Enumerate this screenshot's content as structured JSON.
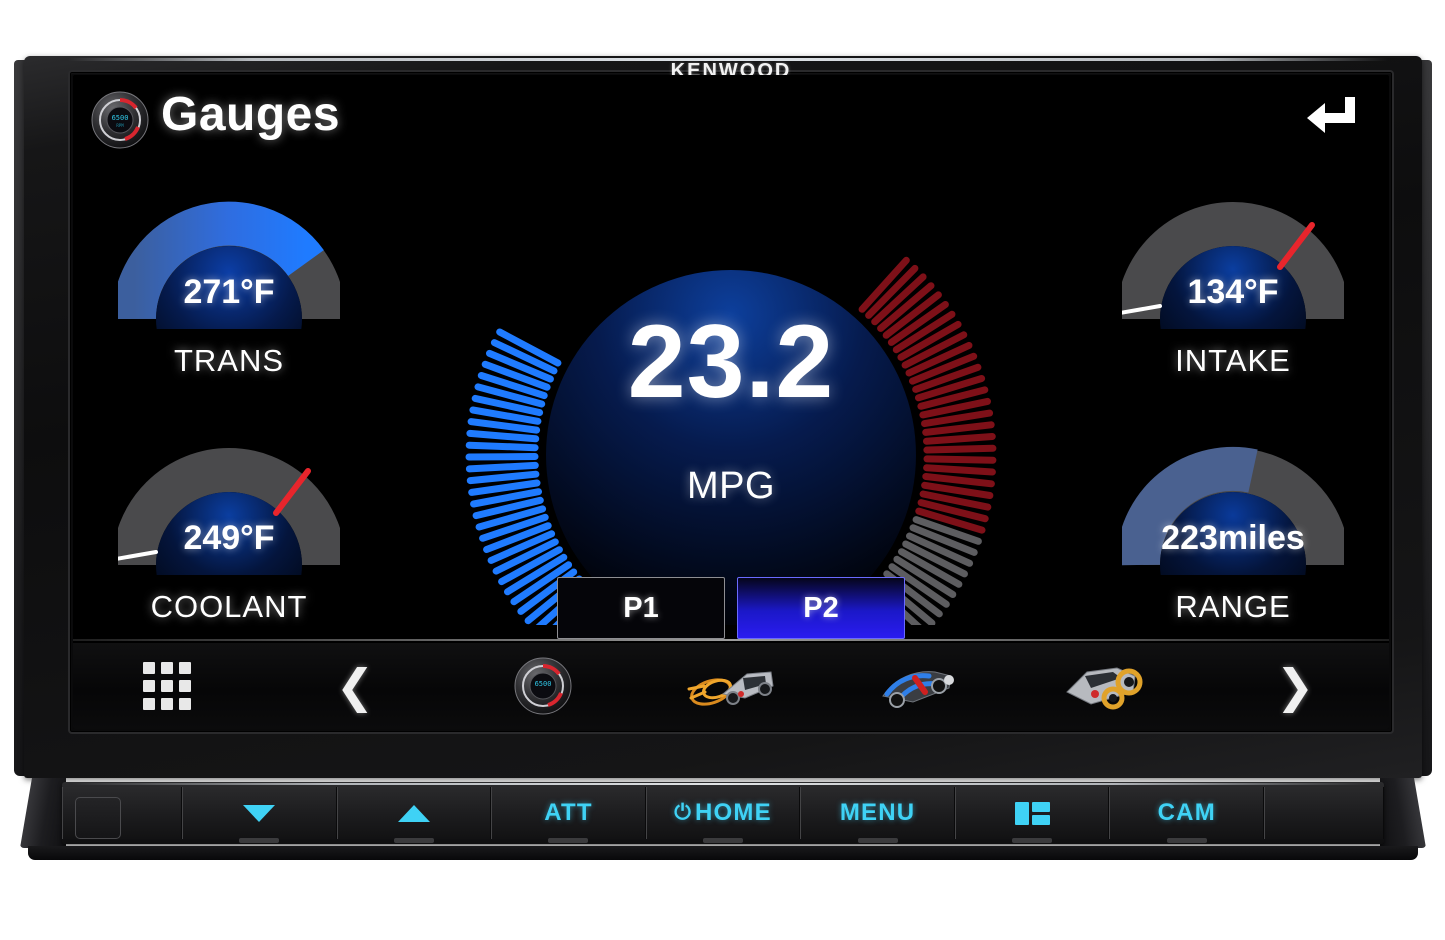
{
  "brand": "KENWOOD",
  "screen": {
    "header": {
      "title": "Gauges",
      "icon": "gauge-dial-icon",
      "back_icon": "back-arrow-icon"
    },
    "gauges": {
      "left": [
        {
          "id": "trans",
          "value": "271°F",
          "label": "TRANS",
          "style": "blue-arc",
          "fill_deg": 250,
          "needle": null
        },
        {
          "id": "coolant",
          "value": "249°F",
          "label": "COOLANT",
          "style": "grey-arc",
          "fill_deg": 0,
          "needle": "red"
        }
      ],
      "right": [
        {
          "id": "intake",
          "value": "134°F",
          "label": "INTAKE",
          "style": "grey-arc",
          "fill_deg": 0,
          "needle": "red"
        },
        {
          "id": "range",
          "value": "223miles",
          "label": "RANGE",
          "style": "dim-blue",
          "fill_deg": 195,
          "needle": null
        }
      ],
      "center": {
        "id": "mpg",
        "value": "23.2",
        "unit": "MPG",
        "tick_count": 100,
        "blue_ticks": 44,
        "grey_ticks": 30,
        "red_ticks": 26
      }
    },
    "presets": [
      {
        "label": "P1",
        "active": false
      },
      {
        "label": "P2",
        "active": true
      }
    ],
    "nav": [
      {
        "id": "apps",
        "icon": "grid-apps-icon",
        "type": "icon"
      },
      {
        "id": "prev",
        "icon": "chevron-left-icon",
        "type": "chevron",
        "glyph": "❮"
      },
      {
        "id": "gauges",
        "icon": "gauge-dial-icon",
        "type": "art"
      },
      {
        "id": "exhaust",
        "icon": "car-exhaust-icon",
        "type": "art"
      },
      {
        "id": "drivetrain",
        "icon": "car-drivetrain-icon",
        "type": "art"
      },
      {
        "id": "brakes",
        "icon": "car-brakes-icon",
        "type": "art"
      },
      {
        "id": "next",
        "icon": "chevron-right-icon",
        "type": "chevron",
        "glyph": "❯"
      }
    ]
  },
  "hardware_keys": [
    {
      "id": "detach",
      "label": "",
      "icon": "eject-button"
    },
    {
      "id": "vol-down",
      "label": "",
      "icon": "triangle-down-icon"
    },
    {
      "id": "vol-up",
      "label": "",
      "icon": "triangle-up-icon"
    },
    {
      "id": "att",
      "label": "ATT",
      "icon": null
    },
    {
      "id": "home",
      "label": "HOME",
      "icon": "power-icon"
    },
    {
      "id": "menu",
      "label": "MENU",
      "icon": null
    },
    {
      "id": "screen",
      "label": "",
      "icon": "screen-layout-icon"
    },
    {
      "id": "cam",
      "label": "CAM",
      "icon": null
    },
    {
      "id": "blank",
      "label": "",
      "icon": null
    }
  ],
  "colors": {
    "accent_cyan": "#3fd2f5",
    "gauge_blue": "#1b6ff5",
    "gauge_blue_bright": "#2b7cff",
    "gauge_grey": "#59595b",
    "gauge_red": "#8b0f16",
    "preset_active": "#2a1cf0",
    "screen_bg": "#000000",
    "text": "#ffffff"
  }
}
